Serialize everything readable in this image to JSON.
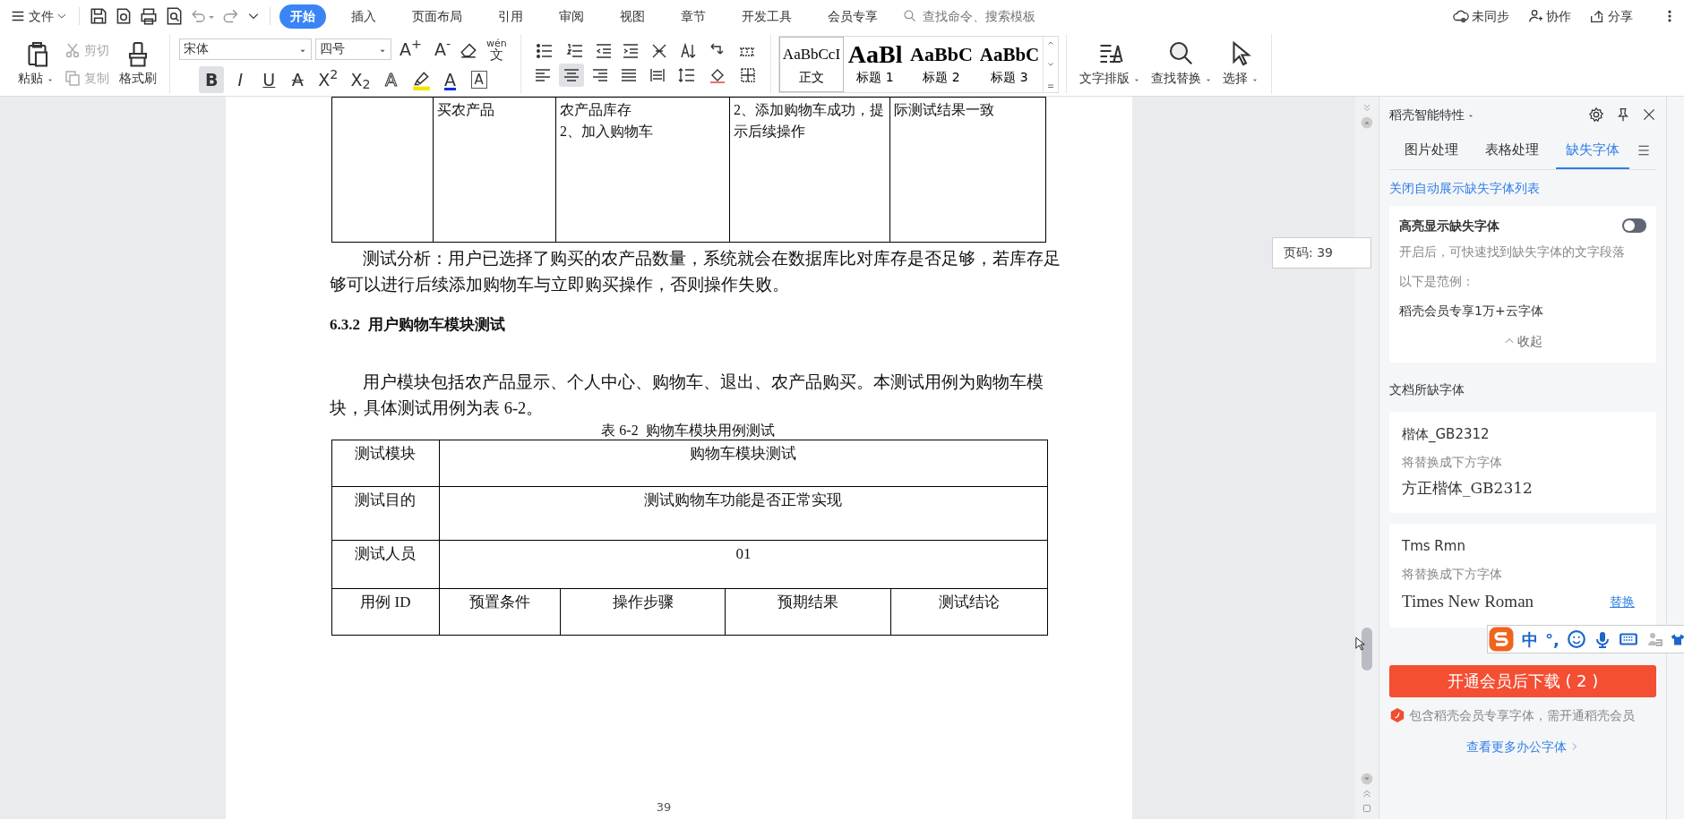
{
  "menubar": {
    "file_menu": "文件",
    "tabs": [
      {
        "label": "开始",
        "selected": true
      },
      {
        "label": "插入",
        "selected": false
      },
      {
        "label": "页面布局",
        "selected": false
      },
      {
        "label": "引用",
        "selected": false
      },
      {
        "label": "审阅",
        "selected": false
      },
      {
        "label": "视图",
        "selected": false
      },
      {
        "label": "章节",
        "selected": false
      },
      {
        "label": "开发工具",
        "selected": false
      },
      {
        "label": "会员专享",
        "selected": false
      }
    ],
    "search": {
      "placeholder": "查找命令、搜索模板"
    },
    "actions": [
      {
        "kind": "sync",
        "label": "未同步"
      },
      {
        "kind": "collab",
        "label": "协作"
      },
      {
        "kind": "share",
        "label": "分享"
      }
    ]
  },
  "ribbon": {
    "clipboard": {
      "paste": "粘贴",
      "cut": {
        "label": "剪切",
        "disabled": true
      },
      "copy": {
        "label": "复制",
        "disabled": true
      },
      "format_painter": "格式刷"
    },
    "font": {
      "name": "宋体",
      "size": "四号",
      "grow": "A$^{+}$",
      "shrink": "A$^{-}$",
      "phonetic": {
        "ruby": "wén",
        "base": "文"
      },
      "buttons": [
        {
          "kind": "bold",
          "label": "B",
          "selected": true
        },
        {
          "kind": "italic",
          "label": "I",
          "selected": false
        },
        {
          "kind": "underline",
          "label": "U",
          "selected": false
        },
        {
          "kind": "strike",
          "label": "A",
          "selected": false
        },
        {
          "kind": "plain",
          "label": "X$^{2}$",
          "selected": false
        },
        {
          "kind": "plain",
          "label": "X$_{2}$",
          "selected": false
        },
        {
          "kind": "effect",
          "label": "A",
          "selected": false
        },
        {
          "kind": "highlight",
          "selected": false
        },
        {
          "kind": "color",
          "label": "A",
          "selected": false
        },
        {
          "kind": "border",
          "label": "A",
          "selected": false
        }
      ]
    },
    "alignment": [
      {
        "selected": false
      },
      {
        "selected": true
      },
      {
        "selected": false
      },
      {
        "selected": false
      },
      {
        "selected": false
      }
    ],
    "styles": [
      {
        "preview": "AaBbCcI",
        "label": "正文",
        "selected": true
      },
      {
        "preview": "AaBl",
        "label": "标题 1",
        "selected": false
      },
      {
        "preview": "AaBbC",
        "label": "标题 2",
        "selected": false
      },
      {
        "preview": "AaBbC",
        "label": "标题 3",
        "selected": false
      }
    ],
    "tools": [
      {
        "kind": "layout",
        "label": "文字排版"
      },
      {
        "kind": "find",
        "label": "查找替换"
      },
      {
        "kind": "select",
        "label": "选择"
      }
    ]
  },
  "document": {
    "cut_table": {
      "cells": [
        null,
        "买农产品",
        "农产品库存\n2、加入购物车",
        "2、添加购物车成功，提示后续操作",
        "际测试结果一致"
      ]
    },
    "analysis": "测试分析：用户已选择了购买的农产品数量，系统就会在数据库比对库存是否足够，若库存足够可以进行后续添加购物车与立即购买操作，否则操作失败。",
    "heading": "6.3.2  用户购物车模块测试",
    "intro": "用户模块包括农产品显示、个人中心、购物车、退出、农产品购买。本测试用例为购物车模块，具体测试用例为表 6-2。",
    "caption": "表 6-2  购物车模块用例测试",
    "table": {
      "rows": [
        {
          "label": "测试模块",
          "value": "购物车模块测试"
        },
        {
          "label": "测试目的",
          "value": "测试购物车功能是否正常实现"
        },
        {
          "label": "测试人员",
          "value": "01"
        }
      ],
      "header": [
        "用例 ID",
        "预置条件",
        "操作步骤",
        "预期结果",
        "测试结论"
      ]
    },
    "page_number": "39"
  },
  "page_indicator": "页码: 39",
  "panel": {
    "title": "稻壳智能特性",
    "tabs": [
      {
        "label": "图片处理",
        "selected": false
      },
      {
        "label": "表格处理",
        "selected": false
      },
      {
        "label": "缺失字体",
        "selected": true
      }
    ],
    "auto_link": "关闭自动展示缺失字体列表",
    "highlight_card": {
      "title": "高亮显示缺失字体",
      "on": false,
      "description": "开启后，可快速找到缺失字体的文字段落",
      "example_label": "以下是范例：",
      "example": "稻壳会员专享1万+云字体",
      "collapse": "收起"
    },
    "section_title": "文档所缺字体",
    "fonts": [
      {
        "missing": "楷体_GB2312",
        "note": "将替换成下方字体",
        "replacement": "方正楷体_GB2312"
      },
      {
        "missing": "Tms Rmn",
        "note": "将替换成下方字体",
        "replacement": "Times New Roman",
        "action": "替换"
      }
    ],
    "download_button": "开通会员后下载 ( 2 )",
    "notice": "包含稻壳会员专享字体，需开通稻壳会员",
    "more_link": "查看更多办公字体"
  },
  "ime_bar": {
    "items": [
      "中",
      "°,"
    ]
  }
}
